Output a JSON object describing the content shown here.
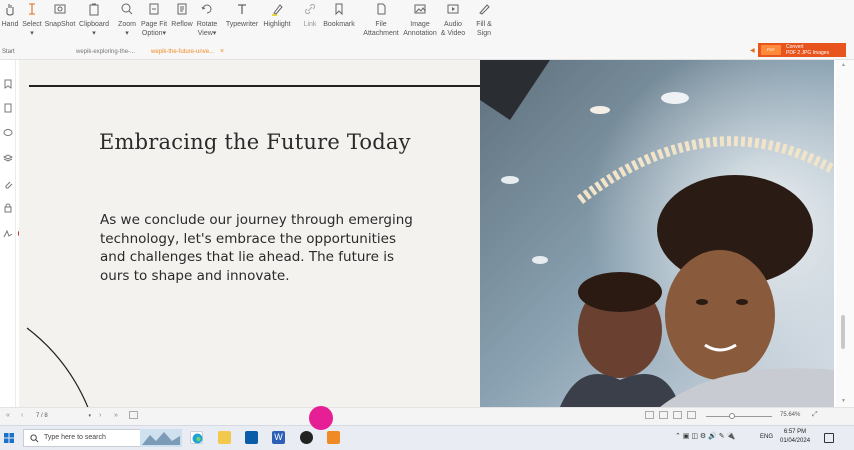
{
  "ribbon": {
    "items": [
      {
        "icon": "hand-icon",
        "label": "Hand",
        "sub": ""
      },
      {
        "icon": "select-cursor-icon",
        "label": "Select",
        "sub": "▾"
      },
      {
        "icon": "snapshot-icon",
        "label": "SnapShot",
        "sub": ""
      },
      {
        "icon": "clipboard-icon",
        "label": "Clipboard",
        "sub": "▾"
      },
      {
        "icon": "zoom-icon",
        "label": "Zoom",
        "sub": "▾"
      },
      {
        "icon": "page-fit-icon",
        "label": "Page Fit",
        "sub": "Option▾"
      },
      {
        "icon": "reflow-icon",
        "label": "Reflow",
        "sub": ""
      },
      {
        "icon": "rotate-icon",
        "label": "Rotate",
        "sub": "View▾"
      },
      {
        "icon": "typewriter-icon",
        "label": "Typewriter",
        "sub": ""
      },
      {
        "icon": "highlight-icon",
        "label": "Highlight",
        "sub": ""
      },
      {
        "icon": "link-icon",
        "label": "Link",
        "sub": ""
      },
      {
        "icon": "bookmark-icon",
        "label": "Bookmark",
        "sub": ""
      },
      {
        "icon": "file-attachment-icon",
        "label": "File",
        "sub": "Attachment"
      },
      {
        "icon": "image-annotation-icon",
        "label": "Image",
        "sub": "Annotation"
      },
      {
        "icon": "audio-video-icon",
        "label": "Audio",
        "sub": "& Video"
      },
      {
        "icon": "fill-sign-icon",
        "label": "Fill &",
        "sub": "Sign"
      }
    ]
  },
  "tabs": {
    "start": "Start",
    "tab1": "wepik-exploring-the-...",
    "tab2": "wepik-the-future-unve...",
    "close": "×"
  },
  "banner": {
    "logo": "PDF",
    "line1": "Convert",
    "line2": "PDF 2 JPG Images"
  },
  "document": {
    "heading": "Embracing the Future Today",
    "body": "As we conclude our journey through emerging technology, let's embrace the opportunities and challenges that lie ahead. The future is ours to shape and innovate."
  },
  "status": {
    "first": "«",
    "prev": "‹",
    "page": "7 / 8",
    "next": "›",
    "last": "»",
    "zoom": "75.64%",
    "fit": "⤢"
  },
  "taskbar": {
    "search_placeholder": "Type here to search",
    "lang": "ENG",
    "time": "6:57 PM",
    "date": "01/04/2024"
  },
  "colors": {
    "accent": "#f08a24",
    "banner": "#e8551c",
    "cursor": "#e6138f"
  }
}
